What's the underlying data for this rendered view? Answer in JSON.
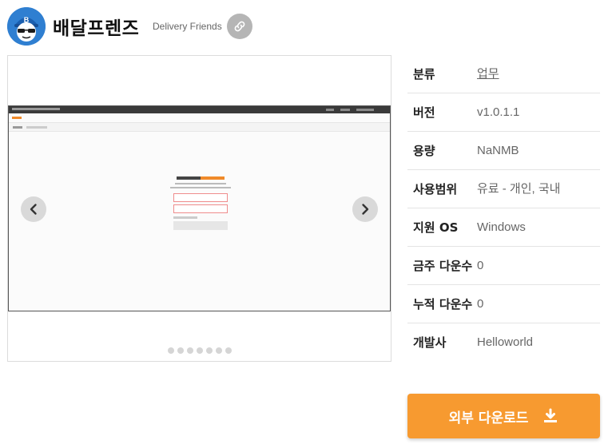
{
  "header": {
    "title": "배달프렌즈",
    "subtitle": "Delivery Friends",
    "logo_icon": "delivery-mascot-logo",
    "logo_letter": "B",
    "link_icon": "link-icon"
  },
  "gallery": {
    "prev_icon": "chevron-left-icon",
    "next_icon": "chevron-right-icon",
    "slide_count": 7,
    "active_slide": 1
  },
  "info": [
    {
      "label": "분류",
      "value": "업무"
    },
    {
      "label": "버전",
      "value": "v1.0.1.1"
    },
    {
      "label": "용량",
      "value": "NaNMB"
    },
    {
      "label": "사용범위",
      "value": "유료 - 개인, 국내"
    },
    {
      "label": "지원 OS",
      "value": "Windows"
    },
    {
      "label": "금주 다운수",
      "value": "0"
    },
    {
      "label": "누적 다운수",
      "value": "0"
    },
    {
      "label": "개발사",
      "value": "Helloworld"
    }
  ],
  "download": {
    "label": "외부 다운로드",
    "icon": "download-icon"
  },
  "colors": {
    "accent": "#f79a30",
    "logo_blue": "#2f7fd1"
  }
}
